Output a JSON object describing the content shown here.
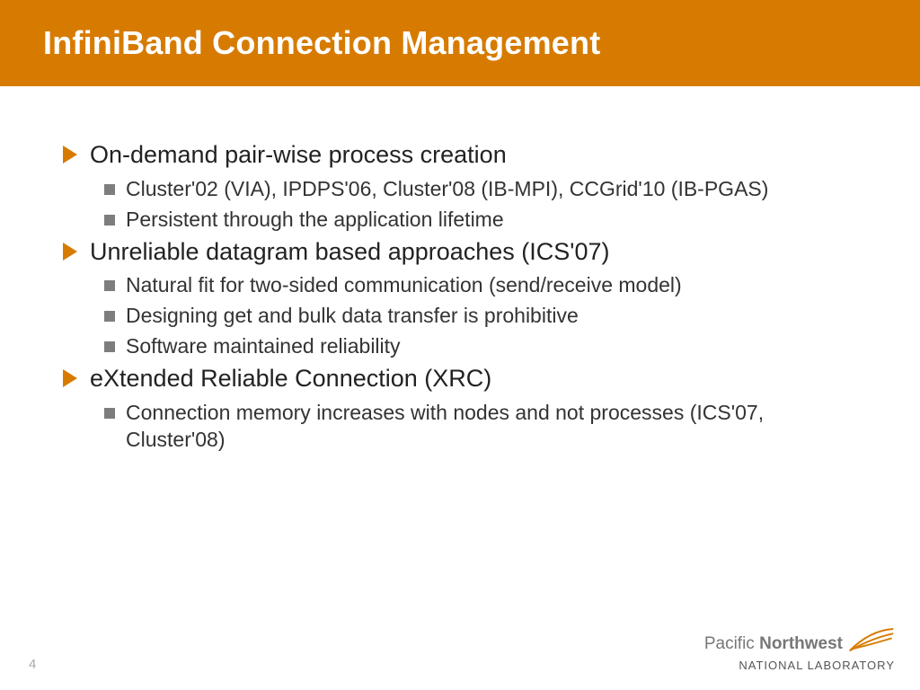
{
  "title": "InfiniBand Connection Management",
  "page_number": "4",
  "bullets": [
    {
      "text": "On-demand pair-wise process creation",
      "sub": [
        "Cluster'02 (VIA), IPDPS'06, Cluster'08  (IB-MPI), CCGrid'10 (IB-PGAS)",
        "Persistent through the application lifetime"
      ]
    },
    {
      "text": "Unreliable datagram based approaches (ICS'07)",
      "sub": [
        "Natural fit for two-sided communication (send/receive model)",
        "Designing get and bulk data transfer is prohibitive",
        "Software maintained reliability"
      ]
    },
    {
      "text": "eXtended Reliable Connection (XRC)",
      "sub": [
        "Connection memory increases with nodes and not processes (ICS'07, Cluster'08)"
      ]
    }
  ],
  "logo": {
    "brand_a": "Pacific",
    "brand_b": "Northwest",
    "sub": "NATIONAL LABORATORY"
  }
}
